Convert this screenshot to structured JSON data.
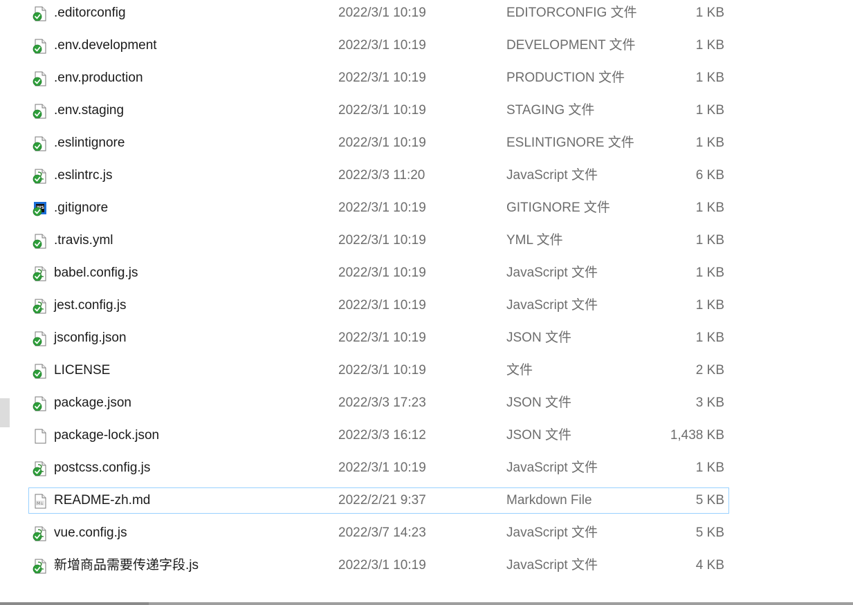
{
  "files": [
    {
      "name": ".editorconfig",
      "date": "2022/3/1 10:19",
      "type": "EDITORCONFIG 文件",
      "size": "1 KB",
      "icon": "generic-check-icon"
    },
    {
      "name": ".env.development",
      "date": "2022/3/1 10:19",
      "type": "DEVELOPMENT 文件",
      "size": "1 KB",
      "icon": "generic-check-icon"
    },
    {
      "name": ".env.production",
      "date": "2022/3/1 10:19",
      "type": "PRODUCTION 文件",
      "size": "1 KB",
      "icon": "generic-check-icon"
    },
    {
      "name": ".env.staging",
      "date": "2022/3/1 10:19",
      "type": "STAGING 文件",
      "size": "1 KB",
      "icon": "generic-check-icon"
    },
    {
      "name": ".eslintignore",
      "date": "2022/3/1 10:19",
      "type": "ESLINTIGNORE 文件",
      "size": "1 KB",
      "icon": "generic-check-icon"
    },
    {
      "name": ".eslintrc.js",
      "date": "2022/3/3 11:20",
      "type": "JavaScript 文件",
      "size": "6 KB",
      "icon": "script-check-icon"
    },
    {
      "name": ".gitignore",
      "date": "2022/3/1 10:19",
      "type": "GITIGNORE 文件",
      "size": "1 KB",
      "icon": "webstorm-check-icon"
    },
    {
      "name": ".travis.yml",
      "date": "2022/3/1 10:19",
      "type": "YML 文件",
      "size": "1 KB",
      "icon": "generic-check-icon"
    },
    {
      "name": "babel.config.js",
      "date": "2022/3/1 10:19",
      "type": "JavaScript 文件",
      "size": "1 KB",
      "icon": "script-check-icon"
    },
    {
      "name": "jest.config.js",
      "date": "2022/3/1 10:19",
      "type": "JavaScript 文件",
      "size": "1 KB",
      "icon": "script-check-icon"
    },
    {
      "name": "jsconfig.json",
      "date": "2022/3/1 10:19",
      "type": "JSON 文件",
      "size": "1 KB",
      "icon": "generic-check-icon"
    },
    {
      "name": "LICENSE",
      "date": "2022/3/1 10:19",
      "type": "文件",
      "size": "2 KB",
      "icon": "generic-check-icon"
    },
    {
      "name": "package.json",
      "date": "2022/3/3 17:23",
      "type": "JSON 文件",
      "size": "3 KB",
      "icon": "generic-check-icon"
    },
    {
      "name": "package-lock.json",
      "date": "2022/3/3 16:12",
      "type": "JSON 文件",
      "size": "1,438 KB",
      "icon": "blank-file-icon"
    },
    {
      "name": "postcss.config.js",
      "date": "2022/3/1 10:19",
      "type": "JavaScript 文件",
      "size": "1 KB",
      "icon": "script-check-icon"
    },
    {
      "name": "README-zh.md",
      "date": "2022/2/21 9:37",
      "type": "Markdown File",
      "size": "5 KB",
      "icon": "markdown-file-icon",
      "selected": true
    },
    {
      "name": "vue.config.js",
      "date": "2022/3/7 14:23",
      "type": "JavaScript 文件",
      "size": "5 KB",
      "icon": "script-check-icon"
    },
    {
      "name": "新增商品需要传递字段.js",
      "date": "2022/3/1 10:19",
      "type": "JavaScript 文件",
      "size": "4 KB",
      "icon": "script-check-icon"
    }
  ],
  "colors": {
    "selection_border": "#99d1ff",
    "check_green": "#2e9f3a",
    "meta_text": "#6d6d6d"
  }
}
